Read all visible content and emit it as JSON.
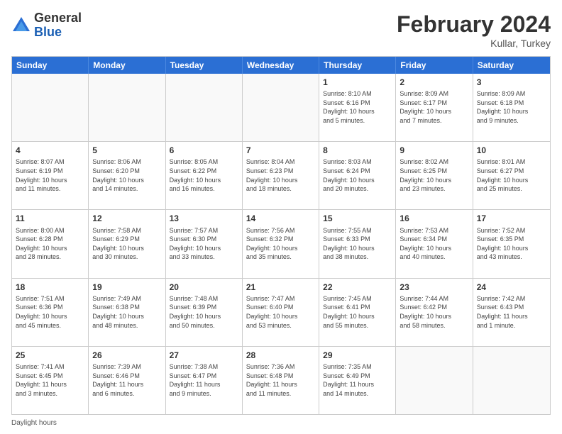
{
  "logo": {
    "general": "General",
    "blue": "Blue"
  },
  "title": "February 2024",
  "location": "Kullar, Turkey",
  "days": [
    "Sunday",
    "Monday",
    "Tuesday",
    "Wednesday",
    "Thursday",
    "Friday",
    "Saturday"
  ],
  "footer": "Daylight hours",
  "weeks": [
    [
      {
        "day": "",
        "text": ""
      },
      {
        "day": "",
        "text": ""
      },
      {
        "day": "",
        "text": ""
      },
      {
        "day": "",
        "text": ""
      },
      {
        "day": "1",
        "text": "Sunrise: 8:10 AM\nSunset: 6:16 PM\nDaylight: 10 hours\nand 5 minutes."
      },
      {
        "day": "2",
        "text": "Sunrise: 8:09 AM\nSunset: 6:17 PM\nDaylight: 10 hours\nand 7 minutes."
      },
      {
        "day": "3",
        "text": "Sunrise: 8:09 AM\nSunset: 6:18 PM\nDaylight: 10 hours\nand 9 minutes."
      }
    ],
    [
      {
        "day": "4",
        "text": "Sunrise: 8:07 AM\nSunset: 6:19 PM\nDaylight: 10 hours\nand 11 minutes."
      },
      {
        "day": "5",
        "text": "Sunrise: 8:06 AM\nSunset: 6:20 PM\nDaylight: 10 hours\nand 14 minutes."
      },
      {
        "day": "6",
        "text": "Sunrise: 8:05 AM\nSunset: 6:22 PM\nDaylight: 10 hours\nand 16 minutes."
      },
      {
        "day": "7",
        "text": "Sunrise: 8:04 AM\nSunset: 6:23 PM\nDaylight: 10 hours\nand 18 minutes."
      },
      {
        "day": "8",
        "text": "Sunrise: 8:03 AM\nSunset: 6:24 PM\nDaylight: 10 hours\nand 20 minutes."
      },
      {
        "day": "9",
        "text": "Sunrise: 8:02 AM\nSunset: 6:25 PM\nDaylight: 10 hours\nand 23 minutes."
      },
      {
        "day": "10",
        "text": "Sunrise: 8:01 AM\nSunset: 6:27 PM\nDaylight: 10 hours\nand 25 minutes."
      }
    ],
    [
      {
        "day": "11",
        "text": "Sunrise: 8:00 AM\nSunset: 6:28 PM\nDaylight: 10 hours\nand 28 minutes."
      },
      {
        "day": "12",
        "text": "Sunrise: 7:58 AM\nSunset: 6:29 PM\nDaylight: 10 hours\nand 30 minutes."
      },
      {
        "day": "13",
        "text": "Sunrise: 7:57 AM\nSunset: 6:30 PM\nDaylight: 10 hours\nand 33 minutes."
      },
      {
        "day": "14",
        "text": "Sunrise: 7:56 AM\nSunset: 6:32 PM\nDaylight: 10 hours\nand 35 minutes."
      },
      {
        "day": "15",
        "text": "Sunrise: 7:55 AM\nSunset: 6:33 PM\nDaylight: 10 hours\nand 38 minutes."
      },
      {
        "day": "16",
        "text": "Sunrise: 7:53 AM\nSunset: 6:34 PM\nDaylight: 10 hours\nand 40 minutes."
      },
      {
        "day": "17",
        "text": "Sunrise: 7:52 AM\nSunset: 6:35 PM\nDaylight: 10 hours\nand 43 minutes."
      }
    ],
    [
      {
        "day": "18",
        "text": "Sunrise: 7:51 AM\nSunset: 6:36 PM\nDaylight: 10 hours\nand 45 minutes."
      },
      {
        "day": "19",
        "text": "Sunrise: 7:49 AM\nSunset: 6:38 PM\nDaylight: 10 hours\nand 48 minutes."
      },
      {
        "day": "20",
        "text": "Sunrise: 7:48 AM\nSunset: 6:39 PM\nDaylight: 10 hours\nand 50 minutes."
      },
      {
        "day": "21",
        "text": "Sunrise: 7:47 AM\nSunset: 6:40 PM\nDaylight: 10 hours\nand 53 minutes."
      },
      {
        "day": "22",
        "text": "Sunrise: 7:45 AM\nSunset: 6:41 PM\nDaylight: 10 hours\nand 55 minutes."
      },
      {
        "day": "23",
        "text": "Sunrise: 7:44 AM\nSunset: 6:42 PM\nDaylight: 10 hours\nand 58 minutes."
      },
      {
        "day": "24",
        "text": "Sunrise: 7:42 AM\nSunset: 6:43 PM\nDaylight: 11 hours\nand 1 minute."
      }
    ],
    [
      {
        "day": "25",
        "text": "Sunrise: 7:41 AM\nSunset: 6:45 PM\nDaylight: 11 hours\nand 3 minutes."
      },
      {
        "day": "26",
        "text": "Sunrise: 7:39 AM\nSunset: 6:46 PM\nDaylight: 11 hours\nand 6 minutes."
      },
      {
        "day": "27",
        "text": "Sunrise: 7:38 AM\nSunset: 6:47 PM\nDaylight: 11 hours\nand 9 minutes."
      },
      {
        "day": "28",
        "text": "Sunrise: 7:36 AM\nSunset: 6:48 PM\nDaylight: 11 hours\nand 11 minutes."
      },
      {
        "day": "29",
        "text": "Sunrise: 7:35 AM\nSunset: 6:49 PM\nDaylight: 11 hours\nand 14 minutes."
      },
      {
        "day": "",
        "text": ""
      },
      {
        "day": "",
        "text": ""
      }
    ]
  ]
}
